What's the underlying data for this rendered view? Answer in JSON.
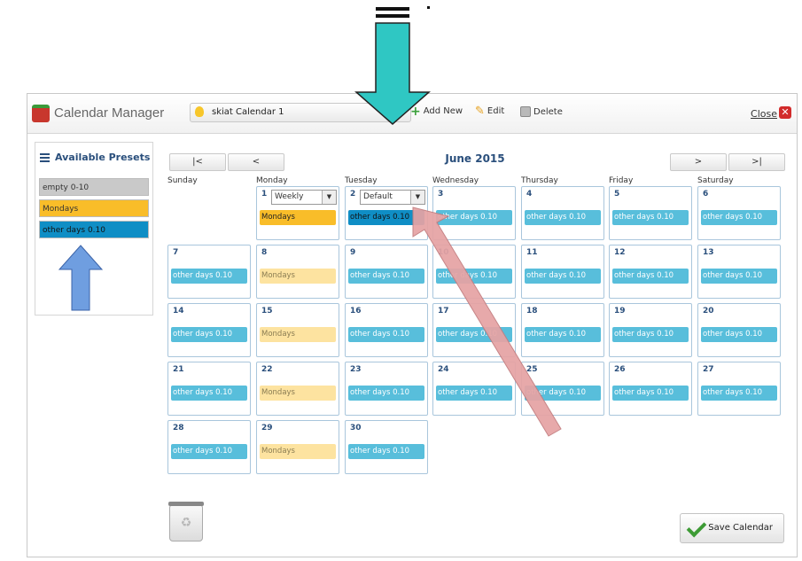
{
  "app": {
    "title": "Calendar Manager"
  },
  "toolbar": {
    "calendar_select": "skiat Calendar 1",
    "add_new": "Add New",
    "edit": "Edit",
    "delete": "Delete",
    "close": "Close"
  },
  "presets": {
    "header": "Available Presets",
    "items": [
      {
        "label": "empty 0-10",
        "color": "#c9c9c9"
      },
      {
        "label": "Mondays",
        "color": "#f9bd29"
      },
      {
        "label": "other days 0.10",
        "color": "#0f8ec5"
      }
    ]
  },
  "nav": {
    "first": "|<",
    "prev": "<",
    "next": ">",
    "last": ">|",
    "month": "June 2015"
  },
  "weekdays": [
    "Sunday",
    "Monday",
    "Tuesday",
    "Wednesday",
    "Thursday",
    "Friday",
    "Saturday"
  ],
  "day_selects": {
    "monday": "Weekly",
    "tuesday": "Default"
  },
  "days": [
    {
      "num": "1",
      "label": "Mondays"
    },
    {
      "num": "2",
      "label": "other days 0.10"
    },
    {
      "num": "3",
      "label": "other days 0.10"
    },
    {
      "num": "4",
      "label": "other days 0.10"
    },
    {
      "num": "5",
      "label": "other days 0.10"
    },
    {
      "num": "6",
      "label": "other days 0.10"
    },
    {
      "num": "7",
      "label": "other days 0.10"
    },
    {
      "num": "8",
      "label": "Mondays"
    },
    {
      "num": "9",
      "label": "other days 0.10"
    },
    {
      "num": "10",
      "label": "other days 0.10"
    },
    {
      "num": "11",
      "label": "other days 0.10"
    },
    {
      "num": "12",
      "label": "other days 0.10"
    },
    {
      "num": "13",
      "label": "other days 0.10"
    },
    {
      "num": "14",
      "label": "other days 0.10"
    },
    {
      "num": "15",
      "label": "Mondays"
    },
    {
      "num": "16",
      "label": "other days 0.10"
    },
    {
      "num": "17",
      "label": "other days 0.10"
    },
    {
      "num": "18",
      "label": "other days 0.10"
    },
    {
      "num": "19",
      "label": "other days 0.10"
    },
    {
      "num": "20",
      "label": "other days 0.10"
    },
    {
      "num": "21",
      "label": "other days 0.10"
    },
    {
      "num": "22",
      "label": "Mondays"
    },
    {
      "num": "23",
      "label": "other days 0.10"
    },
    {
      "num": "24",
      "label": "other days 0.10"
    },
    {
      "num": "25",
      "label": "other days 0.10"
    },
    {
      "num": "26",
      "label": "other days 0.10"
    },
    {
      "num": "27",
      "label": "other days 0.10"
    },
    {
      "num": "28",
      "label": "other days 0.10"
    },
    {
      "num": "29",
      "label": "Mondays"
    },
    {
      "num": "30",
      "label": "other days 0.10"
    }
  ],
  "save": "Save Calendar",
  "colors": {
    "other": "#58bedb",
    "mondays": "#f9bd29",
    "selected": "#0f8ec5",
    "accent": "#2a4f7c"
  }
}
